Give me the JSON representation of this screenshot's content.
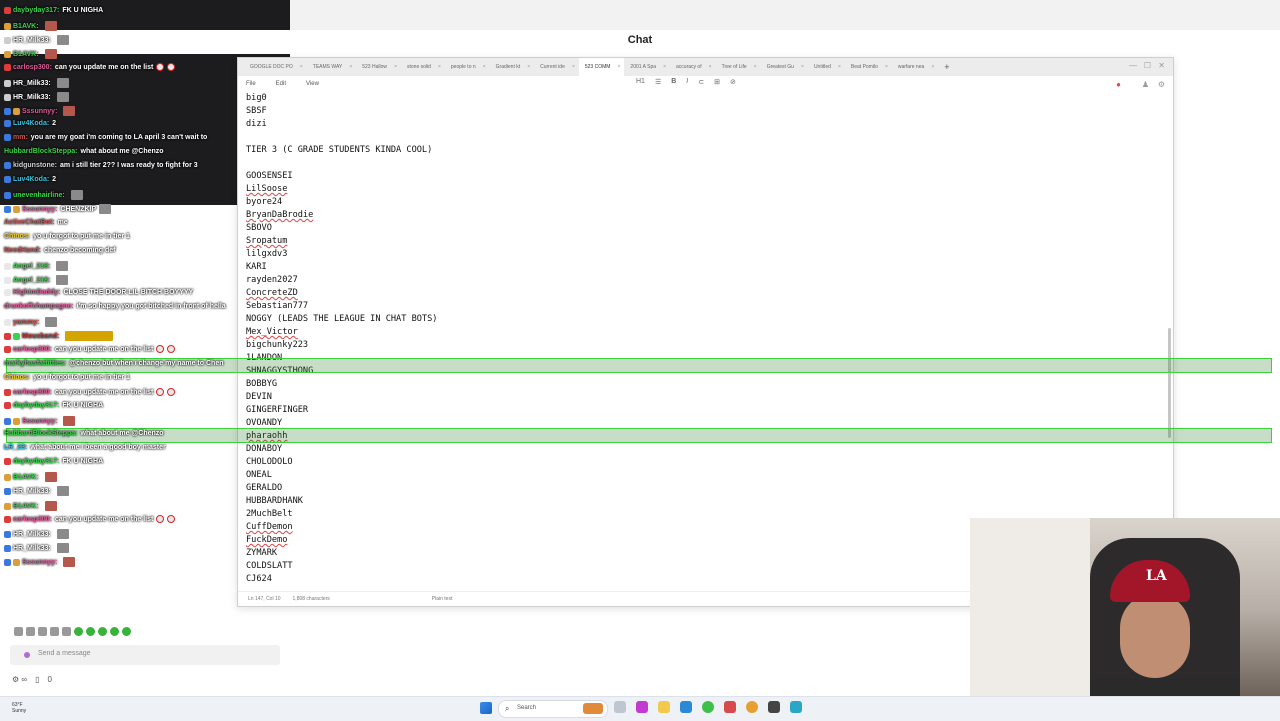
{
  "app": {
    "chat_title": "Chat"
  },
  "notepad": {
    "tabs": [
      {
        "label": "GOOGLE DOC PO"
      },
      {
        "label": "TEAMS WAY"
      },
      {
        "label": "523 Hallow"
      },
      {
        "label": "stone solid"
      },
      {
        "label": "people to n"
      },
      {
        "label": "Gradient kt"
      },
      {
        "label": "Current ide"
      },
      {
        "label": "523 COMM",
        "active": true
      },
      {
        "label": "2001 A Spa"
      },
      {
        "label": "accuracy of"
      },
      {
        "label": "Tree of Life"
      },
      {
        "label": "Greatest Gu"
      },
      {
        "label": "Untitled"
      },
      {
        "label": "Beat Pomilo"
      },
      {
        "label": "warfare nea"
      }
    ],
    "menu": {
      "file": "File",
      "edit": "Edit",
      "view": "View"
    },
    "zoom": "H1",
    "status": {
      "pos": "Ln 147, Col 10",
      "chars": "1,808 characters",
      "mode": "Plain text"
    },
    "lines": [
      {
        "t": "big0"
      },
      {
        "t": "SBSF"
      },
      {
        "t": "dizi"
      },
      {
        "t": ""
      },
      {
        "t": "TIER 3 (C GRADE STUDENTS KINDA COOL)"
      },
      {
        "t": ""
      },
      {
        "t": "GOOSENSEI"
      },
      {
        "t": "LilSoose",
        "sp": true
      },
      {
        "t": "byore24"
      },
      {
        "t": "BryanDaBrodie",
        "sp": true
      },
      {
        "t": "SBOVO"
      },
      {
        "t": "Sropatum",
        "sp": true
      },
      {
        "t": "lilgxdv3"
      },
      {
        "t": "KARI"
      },
      {
        "t": "rayden2027"
      },
      {
        "t": "ConcreteZD",
        "sp": true
      },
      {
        "t": "Sebastian777"
      },
      {
        "t": "NOGGY (LEADS THE LEAGUE IN CHAT BOTS)"
      },
      {
        "t": "Mex_Victor",
        "sp": true
      },
      {
        "t": "bigchunky223"
      },
      {
        "t": "1LANDON"
      },
      {
        "t": "SHNAGGYSTHONG"
      },
      {
        "t": "BOBBYG"
      },
      {
        "t": "DEVIN"
      },
      {
        "t": "GINGERFINGER"
      },
      {
        "t": "OVOANDY"
      },
      {
        "t": "pharaohh",
        "sp": true
      },
      {
        "t": "DONABOY"
      },
      {
        "t": "CHOLODOLO"
      },
      {
        "t": "ONEAL"
      },
      {
        "t": "GERALDO"
      },
      {
        "t": "HUBBARDHANK"
      },
      {
        "t": "2MuchBelt"
      },
      {
        "t": "CuffDemon",
        "sp": true
      },
      {
        "t": "FuckDemo",
        "sp": true
      },
      {
        "t": "ZYMARK"
      },
      {
        "t": "COLDSLATT"
      },
      {
        "t": "CJ624"
      }
    ]
  },
  "chat": {
    "messages": [
      {
        "user": "daybyday317:",
        "text": "FK U NIGHA",
        "color": "#39d44a",
        "badges": [
          "#e03a3a"
        ]
      },
      {
        "user": "B1AVK:",
        "text": "",
        "color": "#39d44a",
        "badges": [
          "#d9a03a"
        ],
        "emote": "red"
      },
      {
        "user": "HR_Milk33:",
        "text": "",
        "color": "#ffffff",
        "badges": [
          "#cccccc"
        ],
        "emote": "grey"
      },
      {
        "user": "B1AVK:",
        "text": "",
        "color": "#39d44a",
        "badges": [
          "#d9a03a"
        ],
        "emote": "red"
      },
      {
        "user": "carlosp300:",
        "text": "can you update me on the list",
        "color": "#e05a9a",
        "badges": [
          "#e03a3a"
        ],
        "dots": 2
      },
      {
        "user": "HR_Milk33:",
        "text": "",
        "color": "#ffffff",
        "badges": [
          "#cccccc"
        ],
        "emote": "grey"
      },
      {
        "user": "HR_Milk33:",
        "text": "",
        "color": "#ffffff",
        "badges": [
          "#cccccc"
        ],
        "emote": "grey"
      },
      {
        "user": "Sssunnyy:",
        "text": "",
        "color": "#e05a9a",
        "badges": [
          "#3a7ae0",
          "#d9a03a"
        ],
        "emote": "red"
      },
      {
        "user": "Luv4Koda:",
        "text": "2",
        "color": "#39c4e0",
        "badges": [
          "#3a7ae0"
        ]
      },
      {
        "user": "mm:",
        "text": "you are my goat i'm coming to LA april 3 can't wait to",
        "color": "#cc5555",
        "badges": [
          "#3a7ae0"
        ]
      },
      {
        "user": "HubbardBlockSteppa:",
        "text": "what about me @Chenzo",
        "color": "#39d44a",
        "badges": []
      },
      {
        "user": "kidgunstone:",
        "text": "am i still tier 2?? I was ready to fight for 3",
        "color": "#d0d0d0",
        "badges": [
          "#3a7ae0"
        ]
      },
      {
        "user": "Luv4Koda:",
        "text": "2",
        "color": "#39c4e0",
        "badges": [
          "#3a7ae0"
        ]
      },
      {
        "user": "unevenhairline:",
        "text": "",
        "color": "#39d44a",
        "badges": [
          "#3a7ae0"
        ],
        "emote": "grey"
      },
      {
        "user": "Sssunnyy:",
        "text": "CHENZKIP",
        "color": "#e05a9a",
        "badges": [
          "#3a7ae0",
          "#d9a03a"
        ],
        "emote": "grey"
      },
      {
        "user": "ActiveChatBot:",
        "text": "me",
        "color": "#cc5555",
        "badges": []
      },
      {
        "user": "Chinos:",
        "text": "yo u forgot to put me in tier 1",
        "color": "#f0d23a",
        "badges": []
      },
      {
        "user": "NeedHand:",
        "text": "chenzo becoming def",
        "color": "#cc5555",
        "badges": []
      },
      {
        "user": "Angel_218:",
        "text": "",
        "color": "#39d44a",
        "badges": [
          "#e8e8e8"
        ],
        "emote": "grey"
      },
      {
        "user": "Angel_218:",
        "text": "",
        "color": "#39d44a",
        "badges": [
          "#e8e8e8"
        ],
        "emote": "grey"
      },
      {
        "user": "HighimDaddy:",
        "text": "CLOSE THE DOOR LIL BITCH BOYYYY",
        "color": "#e05a9a",
        "badges": [
          "#e8e8e8"
        ]
      },
      {
        "user": "drunkoffchampagne:",
        "text": "i'm so happy you got bitched in front of hella",
        "color": "#e05a9a",
        "badges": []
      },
      {
        "user": "yammy:",
        "text": "",
        "color": "#cc5555",
        "badges": [
          "#e8e8e8"
        ],
        "emote": "grey"
      },
      {
        "user": "Mousband:",
        "text": "",
        "color": "#cc3333",
        "badges": [
          "#e03a3a",
          "#39d44a"
        ],
        "emote": "gold"
      },
      {
        "user": "carlosp300:",
        "text": "can you update me on the list",
        "color": "#e05a9a",
        "badges": [
          "#e03a3a"
        ],
        "dots": 2
      },
      {
        "user": "markyhasfattitties:",
        "text": "@chenzo but when i change my name to Chen",
        "color": "#39d44a",
        "badges": [],
        "highlight": true
      },
      {
        "user": "Chinos:",
        "text": "yo u forgot to put me in tier 1",
        "color": "#f0d23a",
        "badges": []
      },
      {
        "user": "carlosp300:",
        "text": "can you update me on the list",
        "color": "#e05a9a",
        "badges": [
          "#e03a3a"
        ],
        "dots": 2
      },
      {
        "user": "daybyday317:",
        "text": "FK U NIGHA",
        "color": "#39d44a",
        "badges": [
          "#e03a3a"
        ]
      },
      {
        "user": "Sssunnyy:",
        "text": "",
        "color": "#e05a9a",
        "badges": [
          "#3a7ae0",
          "#d9a03a"
        ],
        "emote": "red"
      },
      {
        "user": "HubbardBlockSteppa:",
        "text": "what about me @Chenzo",
        "color": "#39d44a",
        "badges": [],
        "highlight": true
      },
      {
        "user": "LR_23:",
        "text": "what about me i been a good boy master",
        "color": "#39c4e0",
        "badges": []
      },
      {
        "user": "daybyday317:",
        "text": "FK U NIGHA",
        "color": "#39d44a",
        "badges": [
          "#e03a3a"
        ]
      },
      {
        "user": "B1AVK:",
        "text": "",
        "color": "#39d44a",
        "badges": [
          "#d9a03a"
        ],
        "emote": "red"
      },
      {
        "user": "HR_Milk33:",
        "text": "",
        "color": "#ffffff",
        "badges": [
          "#3a7ae0"
        ],
        "emote": "grey"
      },
      {
        "user": "B1AVK:",
        "text": "",
        "color": "#39d44a",
        "badges": [
          "#d9a03a"
        ],
        "emote": "red"
      },
      {
        "user": "carlosp300:",
        "text": "can you update me on the list",
        "color": "#e05a9a",
        "badges": [
          "#e03a3a"
        ],
        "dots": 2
      },
      {
        "user": "HR_Milk33:",
        "text": "",
        "color": "#ffffff",
        "badges": [
          "#3a7ae0"
        ],
        "emote": "grey"
      },
      {
        "user": "HR_Milk33:",
        "text": "",
        "color": "#ffffff",
        "badges": [
          "#3a7ae0"
        ],
        "emote": "grey"
      },
      {
        "user": "Sssunnyy:",
        "text": "",
        "color": "#e05a9a",
        "badges": [
          "#3a7ae0",
          "#d9a03a"
        ],
        "emote": "red"
      }
    ],
    "input_placeholder": "Send a message",
    "viewer_count": "0"
  },
  "taskbar": {
    "weather_temp": "63°F",
    "weather_desc": "Sunny",
    "search_label": "Search"
  }
}
